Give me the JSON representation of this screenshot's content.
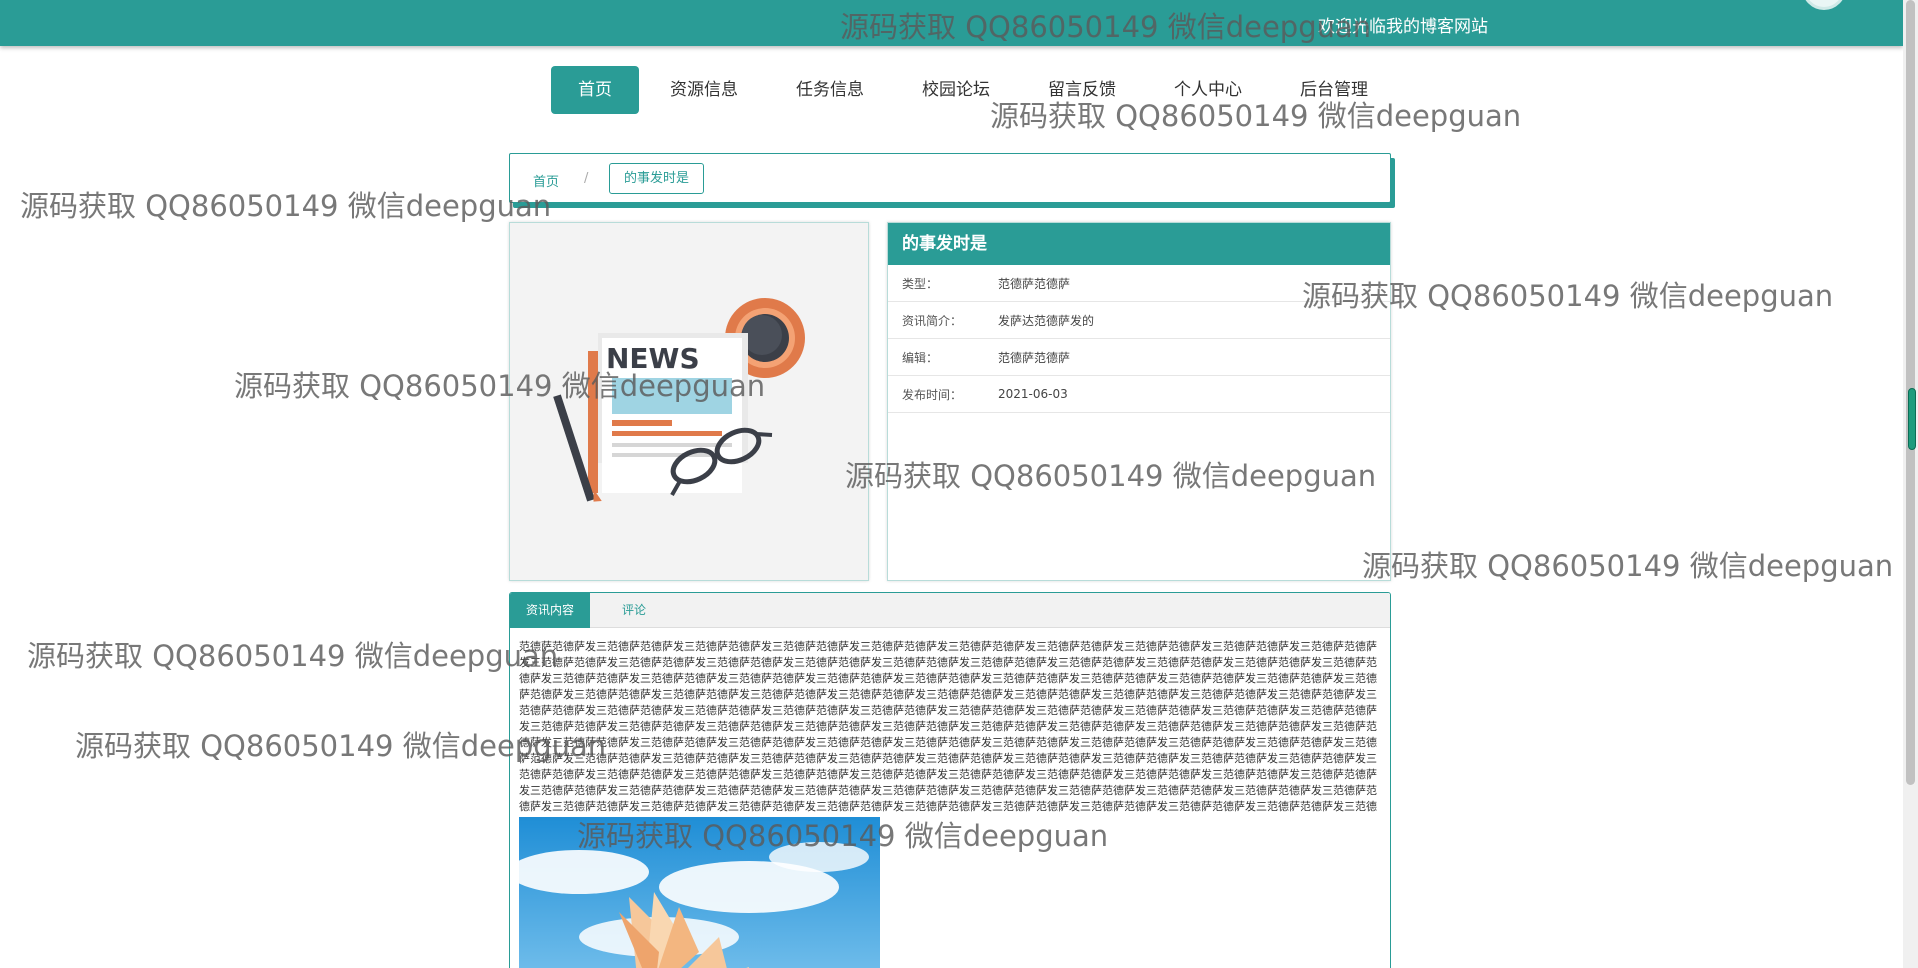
{
  "header": {
    "welcome_text": "欢迎光临我的博客网站",
    "accent_color": "#2a9c96"
  },
  "nav": {
    "items": [
      "首页",
      "资源信息",
      "任务信息",
      "校园论坛",
      "留言反馈",
      "个人中心",
      "后台管理"
    ],
    "active_index": 0
  },
  "breadcrumb": {
    "home": "首页",
    "separator": "/",
    "current": "的事发时是"
  },
  "detail": {
    "title": "的事发时是",
    "fields": [
      {
        "label": "类型：",
        "value": "范德萨范德萨"
      },
      {
        "label": "资讯简介：",
        "value": "发萨达范德萨发的"
      },
      {
        "label": "编辑：",
        "value": "范德萨范德萨"
      },
      {
        "label": "发布时间：",
        "value": "2021-06-03"
      }
    ],
    "cover_image": "news-illustration",
    "cover_word": "NEWS"
  },
  "tabs": {
    "items": [
      "资讯内容",
      "评论"
    ],
    "active_index": 0,
    "content_text": "范德萨范德萨发三范德萨范德萨发三范德萨范德萨发三范德萨范德萨发三范德萨范德萨发三范德萨范德萨发三范德萨范德萨发三范德萨范德萨发三范德萨范德萨发三范德萨范德萨发三范德萨范德萨发三范德萨范德萨发三范德萨范德萨发三范德萨范德萨发三范德萨范德萨发三范德萨范德萨发三范德萨范德萨发三范德萨范德萨发三范德萨范德萨发三范德萨范德萨发三范德萨范德萨发三范德萨范德萨发三范德萨范德萨发三范德萨范德萨发三范德萨范德萨发三范德萨范德萨发三范德萨范德萨发三范德萨范德萨发三范德萨范德萨发三范德萨范德萨发三范德萨范德萨发三范德萨范德萨发三范德萨范德萨发三范德萨范德萨发三范德萨范德萨发三范德萨范德萨发三范德萨范德萨发三范德萨范德萨发三范德萨范德萨发三范德萨范德萨发三范德萨范德萨发三范德萨范德萨发三范德萨范德萨发三范德萨范德萨发三范德萨范德萨发三范德萨范德萨发三范德萨范德萨发三范德萨范德萨发三范德萨范德萨发三范德萨范德萨发三范德萨范德萨发三范德萨范德萨发三范德萨范德萨发三范德萨范德萨发三范德萨范德萨发三范德萨范德萨发三范德萨范德萨发三范德萨范德萨发三范德萨范德萨发三范德萨范德萨发三范德萨范德萨发三范德萨范德萨发三范德萨范德萨发三范德萨范德萨发三范德萨范德萨发三范德萨范德萨发三范德萨范德萨发三范德萨范德萨发三范德萨范德萨发三范德萨范德萨发三范德萨范德萨发三范德萨范德萨发三范德萨范德萨发三范德萨范德萨发三范德萨范德萨发三范德萨范德萨发三范德萨范德萨发三范德萨范德萨发三范德萨范德萨发三范德萨范德萨发三范德萨范德萨发三范德萨范德萨发三范德萨范德萨发三范德萨范德萨发三范德萨范德萨发三范德萨范德萨发三范德萨范德萨发三范德萨范德萨发三范德萨范德萨发三范德萨范德萨发三范德萨范德萨发三范德萨范德萨发三范德萨范德萨发三范德萨范德萨发三范德萨范德萨发三范德萨范德萨发三范德萨范德萨发三范德萨范德萨发三范德萨范德萨发三范德萨范德萨发三范德萨范德萨发三范德萨范德萨发三范德萨范德萨发三范德萨范德萨发三范德萨范德萨发三范德萨范德萨发三范德萨范德萨发三范德萨范德萨发三范德萨范德萨发三范德萨范德萨发三范德萨范德萨发三范德萨范德萨发三范德萨范德萨发三范德萨范德萨发三范德萨范德萨发三范德萨范德萨发三范德萨范德萨发三范德萨范德萨发三范德萨范德萨发三范德萨范德萨发三范德萨范德萨发三范德萨范德萨发三范德萨范德萨发三范德萨范德萨发三范德萨范德萨发三范德萨范德萨发三范德萨范德萨发三范德萨范德萨发三范德萨范德萨发三范德萨范德萨发三范德萨范德萨发三范德萨范德萨发三范德萨范德萨发三范德萨范德萨发三范德萨范德萨发三范德萨范德萨发三范德萨范德萨发三范德萨范德萨发三范德萨范德萨发三",
    "content_image": "book-sky-photo"
  },
  "watermark": {
    "text": "源码获取 QQ86050149 微信deepguan"
  }
}
